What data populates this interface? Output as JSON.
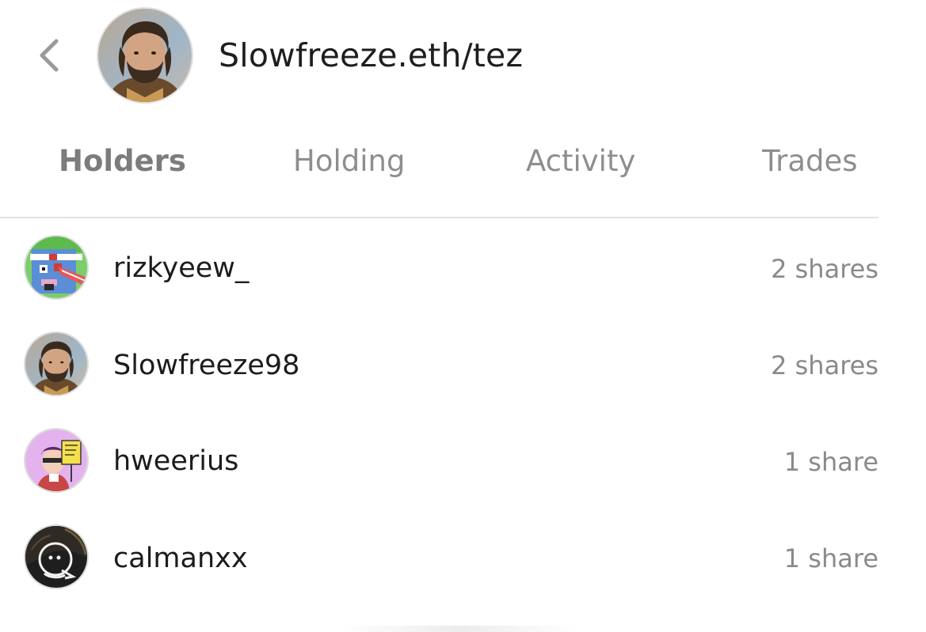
{
  "header": {
    "back_icon": "chevron-left-icon",
    "title": "Slowfreeze.eth/tez"
  },
  "tabs": [
    {
      "label": "Holders",
      "active": true
    },
    {
      "label": "Holding",
      "active": false
    },
    {
      "label": "Activity",
      "active": false
    },
    {
      "label": "Trades",
      "active": false
    }
  ],
  "holders": [
    {
      "name": "rizkyeew_",
      "shares": "2 shares"
    },
    {
      "name": "Slowfreeze98",
      "shares": "2 shares"
    },
    {
      "name": "hweerius",
      "shares": "1 share"
    },
    {
      "name": "calmanxx",
      "shares": "1 share"
    }
  ],
  "colors": {
    "title_text": "#1e1e1e",
    "tab_inactive": "#8e8e8e",
    "tab_active": "#7c7c7c",
    "shares_text": "#8a8a8a",
    "divider": "#e2e2e2"
  }
}
